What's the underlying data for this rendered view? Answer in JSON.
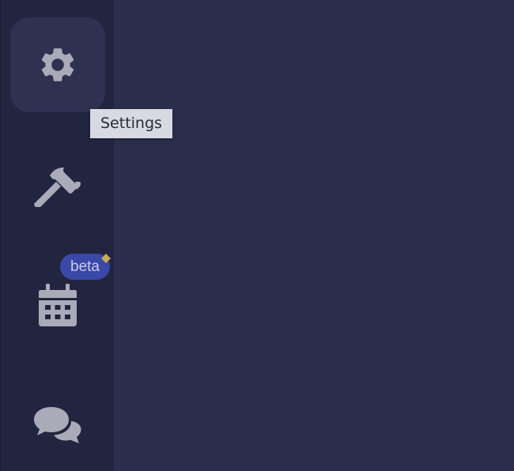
{
  "sidebar": {
    "items": [
      {
        "id": "settings",
        "icon": "gear-icon",
        "active": true
      },
      {
        "id": "tools",
        "icon": "hammer-icon",
        "active": false
      },
      {
        "id": "calendar",
        "icon": "calendar-icon",
        "active": false,
        "badge": "beta"
      },
      {
        "id": "chat",
        "icon": "chat-bubbles-icon",
        "active": false
      }
    ]
  },
  "tooltip": {
    "text": "Settings"
  },
  "badge": {
    "label": "beta"
  },
  "colors": {
    "sidebar_bg": "#222540",
    "main_bg": "#2b2e4b",
    "active_item_bg": "#2e3150",
    "icon_color": "#a9abb8",
    "tooltip_bg": "#d9d9e3",
    "badge_bg": "#3a48a8",
    "sparkle": "#c8a95a"
  }
}
